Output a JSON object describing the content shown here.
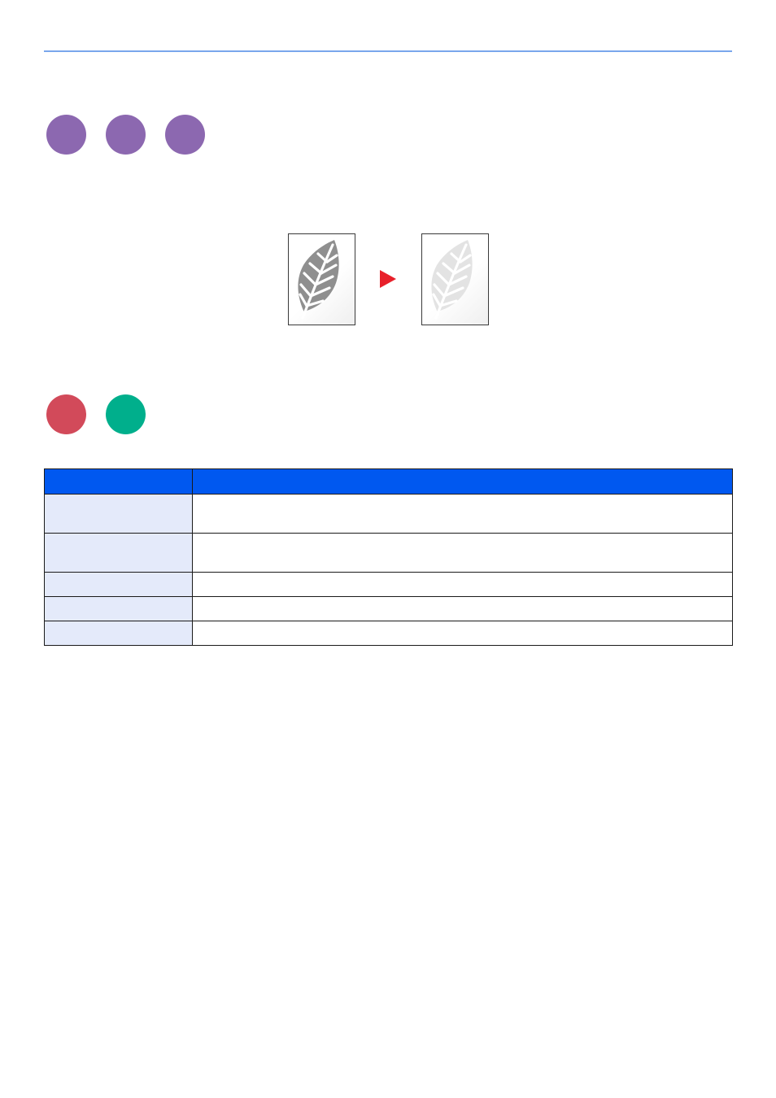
{
  "colors": {
    "top_rule": "#7aa6ec",
    "badge_purple": "#8c68b0",
    "badge_red": "#d24a5a",
    "badge_green": "#00af8c",
    "table_header": "#0058f0",
    "table_key_cell": "#e4eafa",
    "arrow": "#e8202a",
    "leaf_original": "#8f8f8f",
    "leaf_light": "#e3e3e3"
  },
  "badges_top": [
    {
      "icon": "purple-circle-icon",
      "color": "#8c68b0"
    },
    {
      "icon": "purple-circle-icon",
      "color": "#8c68b0"
    },
    {
      "icon": "purple-circle-icon",
      "color": "#8c68b0"
    }
  ],
  "badges_bottom": [
    {
      "icon": "red-circle-icon",
      "color": "#d24a5a"
    },
    {
      "icon": "green-circle-icon",
      "color": "#00af8c"
    }
  ],
  "illustration": {
    "before_icon": "leaf-dark-icon",
    "arrow_icon": "right-triangle-arrow-icon",
    "after_icon": "leaf-light-icon"
  },
  "table": {
    "header": {
      "col1": "",
      "col2": ""
    },
    "rows": [
      {
        "key": "",
        "value": ""
      },
      {
        "key": "",
        "value": ""
      },
      {
        "key": "",
        "value": ""
      },
      {
        "key": "",
        "value": ""
      },
      {
        "key": "",
        "value": ""
      }
    ]
  }
}
